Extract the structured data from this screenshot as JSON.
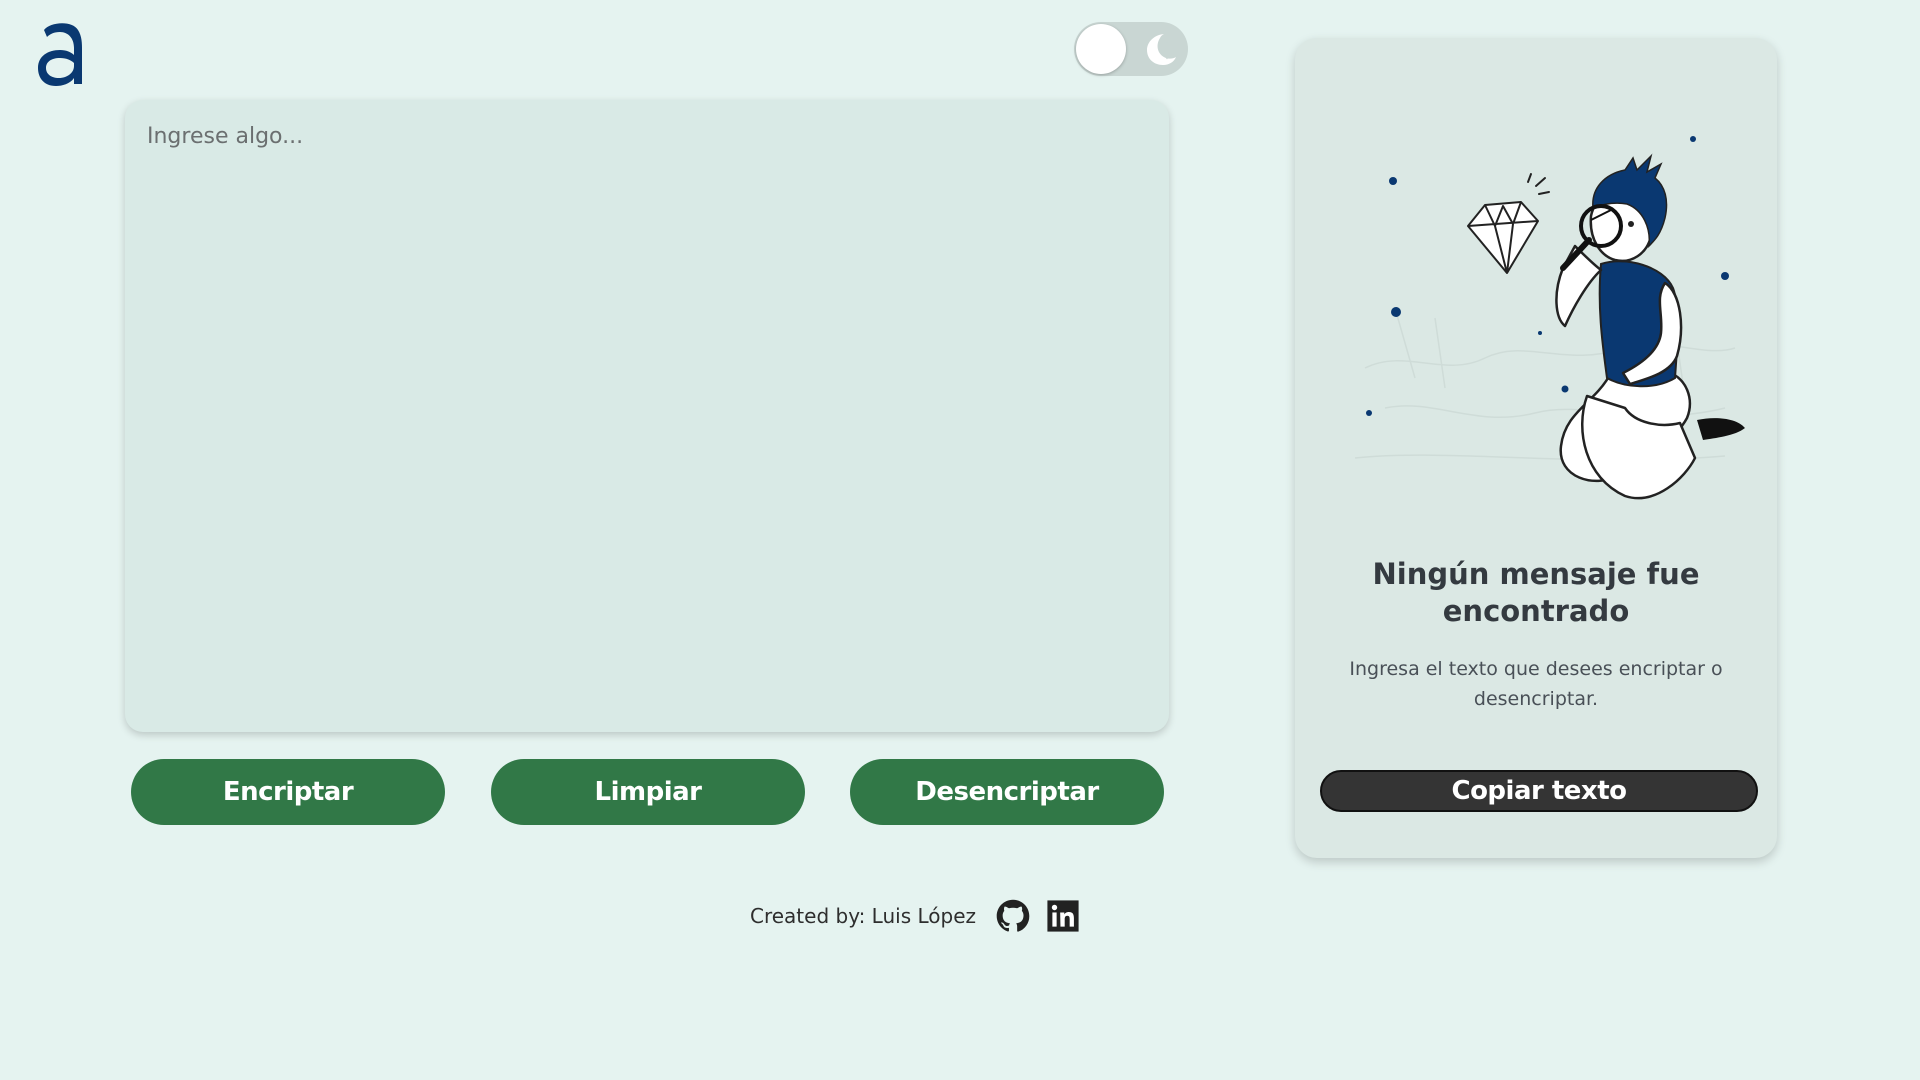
{
  "header": {
    "logo_icon": "alura-a-logo-icon",
    "theme_toggle": {
      "icon": "moon-icon",
      "state": "light"
    }
  },
  "editor": {
    "placeholder": "Ingrese algo...",
    "value": ""
  },
  "actions": {
    "encrypt_label": "Encriptar",
    "clear_label": "Limpiar",
    "decrypt_label": "Desencriptar"
  },
  "result": {
    "illustration": "person-with-magnifier-looking-at-diamond",
    "title": "Ningún mensaje fue encontrado",
    "description": "Ingresa el texto que desees encriptar o desencriptar.",
    "copy_label": "Copiar texto"
  },
  "footer": {
    "credit": "Created by: Luis López",
    "github_icon": "github-icon",
    "linkedin_icon": "linkedin-icon"
  },
  "colors": {
    "background": "#e5f3f0",
    "primary_button": "#317847",
    "copy_button": "#343434",
    "logo": "#0a3871",
    "card": "#d9eae6"
  }
}
